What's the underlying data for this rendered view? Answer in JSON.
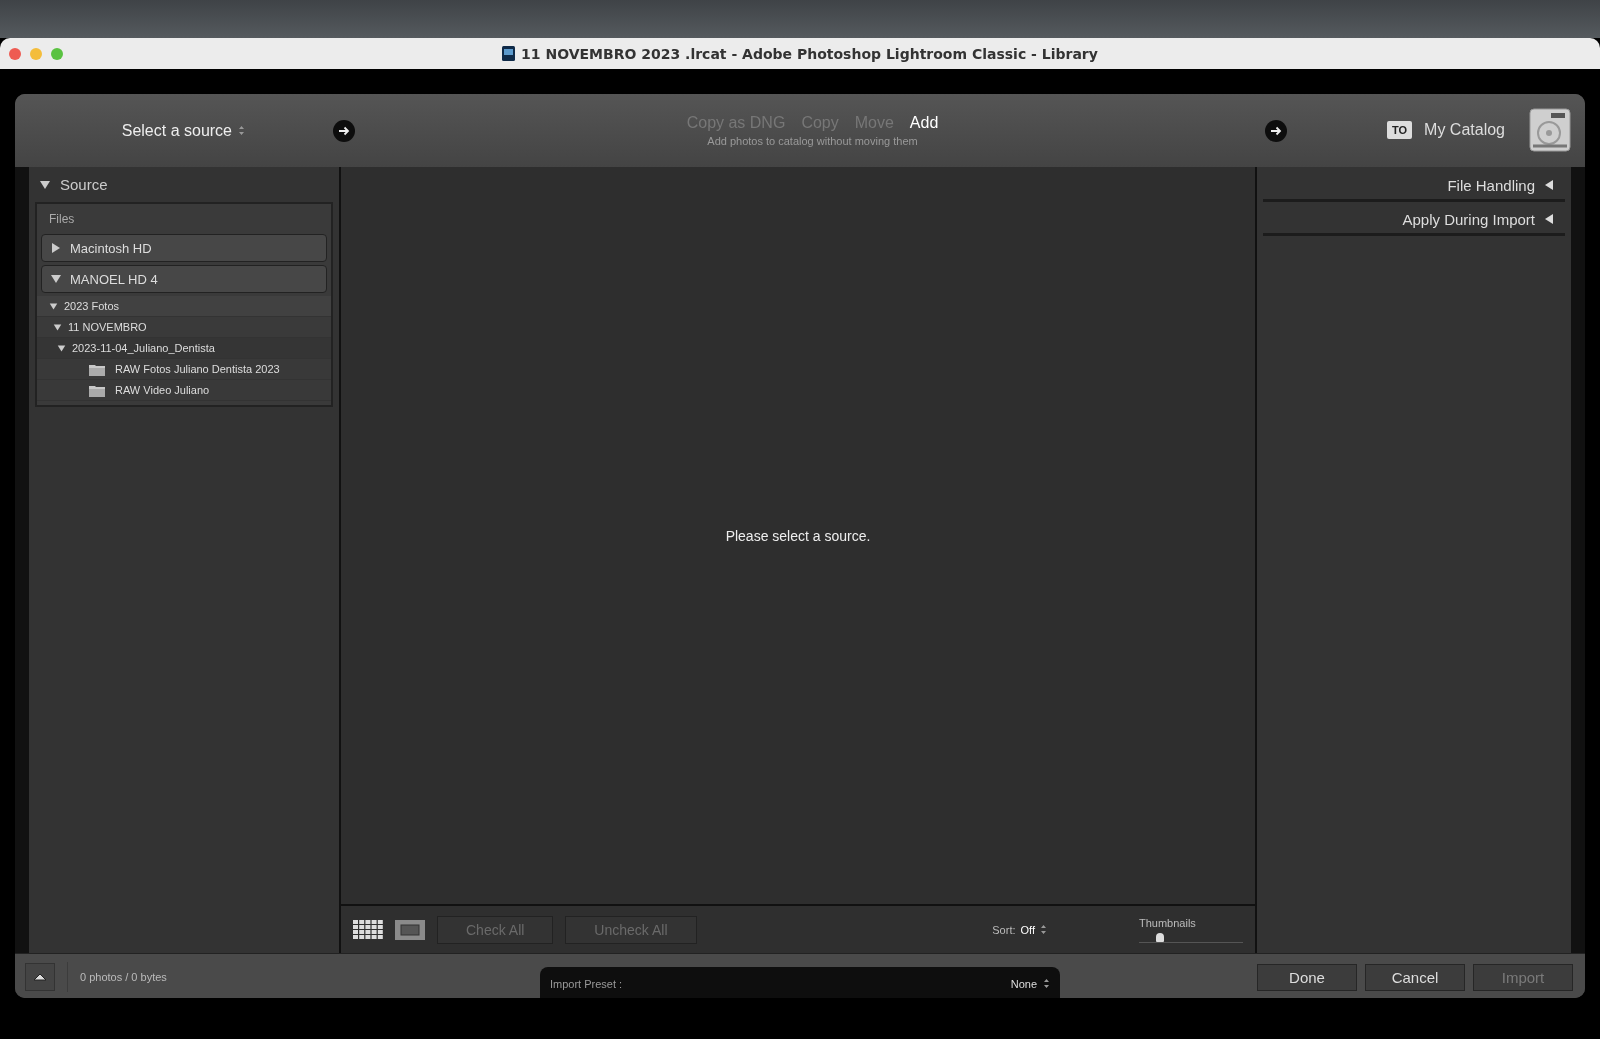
{
  "window": {
    "title": "11 NOVEMBRO 2023 .lrcat - Adobe Photoshop Lightroom Classic - Library"
  },
  "header": {
    "source_label": "Select a source",
    "modes": [
      {
        "label": "Copy as DNG",
        "selected": false
      },
      {
        "label": "Copy",
        "selected": false
      },
      {
        "label": "Move",
        "selected": false
      },
      {
        "label": "Add",
        "selected": true
      }
    ],
    "mode_description": "Add photos to catalog without moving them",
    "to_badge": "TO",
    "destination": "My Catalog"
  },
  "source_panel": {
    "title": "Source",
    "expanded": true,
    "section": "Files",
    "items": [
      {
        "kind": "volume",
        "label": "Macintosh HD",
        "expanded": false
      },
      {
        "kind": "volume",
        "label": "MANOEL HD 4",
        "expanded": true,
        "children": [
          {
            "kind": "folder",
            "label": "2023 Fotos",
            "expanded": true,
            "children": [
              {
                "kind": "folder",
                "label": "11 NOVEMBRO",
                "expanded": true,
                "children": [
                  {
                    "kind": "folder",
                    "label": "2023-11-04_Juliano_Dentista",
                    "expanded": true,
                    "children": [
                      {
                        "kind": "leaf",
                        "label": "RAW Fotos Juliano Dentista 2023"
                      },
                      {
                        "kind": "leaf",
                        "label": "RAW Video Juliano"
                      }
                    ]
                  }
                ]
              }
            ]
          }
        ]
      }
    ]
  },
  "center": {
    "message": "Please select a source.",
    "check_all": {
      "label": "Check All",
      "disabled": true
    },
    "uncheck_all": {
      "label": "Uncheck All",
      "disabled": true
    },
    "sort_label": "Sort:",
    "sort_value": "Off",
    "thumbnails_label": "Thumbnails",
    "thumbnails": {
      "level": 0.2
    }
  },
  "right_panels": [
    {
      "title": "File Handling",
      "expanded": false
    },
    {
      "title": "Apply During Import",
      "expanded": false
    }
  ],
  "footer": {
    "status": "0 photos / 0 bytes",
    "preset_label": "Import Preset :",
    "preset_value": "None",
    "buttons": [
      {
        "label": "Done",
        "disabled": false
      },
      {
        "label": "Cancel",
        "disabled": false
      },
      {
        "label": "Import",
        "disabled": true
      }
    ]
  }
}
